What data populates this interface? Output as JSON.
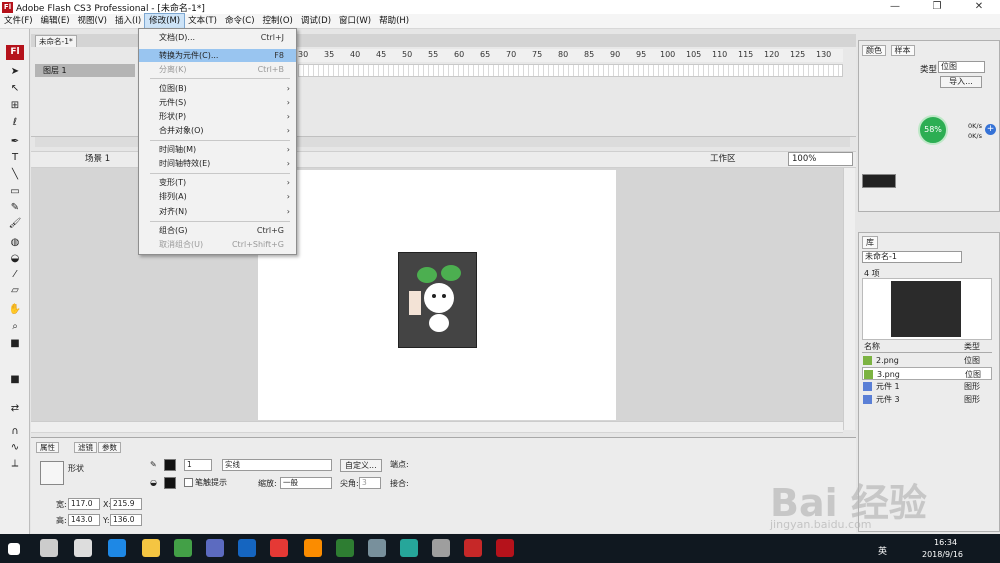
{
  "window": {
    "title": "Adobe Flash CS3 Professional - [未命名-1*]",
    "controls": [
      "—",
      "❐",
      "✕"
    ]
  },
  "menubar": [
    "文件(F)",
    "编辑(E)",
    "视图(V)",
    "插入(I)",
    "修改(M)",
    "文本(T)",
    "命令(C)",
    "控制(O)",
    "调试(D)",
    "窗口(W)",
    "帮助(H)"
  ],
  "menubar_active": "修改(M)",
  "modify_menu": {
    "items": [
      {
        "label": "文档(D)...",
        "shortcut": "Ctrl+J"
      },
      {
        "label": "转换为元件(C)...",
        "shortcut": "F8",
        "highlighted": true
      },
      {
        "label": "分离(K)",
        "shortcut": "Ctrl+B",
        "disabled": true
      },
      {
        "label": "位图(B)",
        "submenu": true
      },
      {
        "label": "元件(S)",
        "submenu": true
      },
      {
        "label": "形状(P)",
        "submenu": true
      },
      {
        "label": "合并对象(O)",
        "submenu": true
      },
      {
        "label": "时间轴(M)",
        "submenu": true
      },
      {
        "label": "时间轴特效(E)",
        "submenu": true
      },
      {
        "label": "变形(T)",
        "submenu": true
      },
      {
        "label": "排列(A)",
        "submenu": true
      },
      {
        "label": "对齐(N)",
        "submenu": true
      },
      {
        "label": "组合(G)",
        "shortcut": "Ctrl+G"
      },
      {
        "label": "取消组合(U)",
        "shortcut": "Ctrl+Shift+G",
        "disabled": true
      }
    ]
  },
  "document": {
    "tab": "未命名-1*",
    "layer": "图层 1",
    "ruler": [
      "30",
      "35",
      "40",
      "45",
      "50",
      "55",
      "60",
      "65",
      "70",
      "75",
      "80",
      "85",
      "90",
      "95",
      "100",
      "105",
      "110",
      "115",
      "120",
      "125",
      "130"
    ],
    "scene": "场景 1",
    "workspace": "工作区",
    "zoom": "100%"
  },
  "properties": {
    "tabs": [
      "属性",
      "滤镜",
      "参数"
    ],
    "shape_label": "形状",
    "stroke_height": "1",
    "stroke_style": "实线",
    "custom_button": "自定义...",
    "endpoint_label": "端点:",
    "stroke_hint_label": "笔触提示",
    "scale_label": "缩放:",
    "scale_value": "一般",
    "miter_label": "尖角:",
    "miter_value": "3",
    "join_label": "接合:",
    "width_label": "宽:",
    "width_value": "117.0",
    "height_label": "高:",
    "height_value": "143.0",
    "x_label": "X:",
    "x_value": "215.9",
    "y_label": "Y:",
    "y_value": "136.0"
  },
  "color_panel": {
    "tabs": [
      "颜色",
      "样本"
    ],
    "type_label": "类型:",
    "type_value": "位图",
    "import_button": "导入..."
  },
  "net_widget": {
    "percent": "58%",
    "up": "0K/s",
    "down": "0K/s"
  },
  "library": {
    "tab": "库",
    "document": "未命名-1",
    "count": "4 项",
    "col_name": "名称",
    "col_type": "类型",
    "items": [
      {
        "name": "2.png",
        "type": "位图"
      },
      {
        "name": "3.png",
        "type": "位图"
      },
      {
        "name": "元件 1",
        "type": "图形"
      },
      {
        "name": "元件 3",
        "type": "图形"
      }
    ]
  },
  "taskbar": {
    "ime": "英",
    "time": "16:34",
    "date": "2018/9/16"
  },
  "watermark": {
    "main": "Bai 经验",
    "sub": "jingyan.baidu.com"
  },
  "colors": {
    "flash_red": "#b5121b",
    "menu_highlight": "#99c5f0",
    "net_green": "#2cae53"
  }
}
